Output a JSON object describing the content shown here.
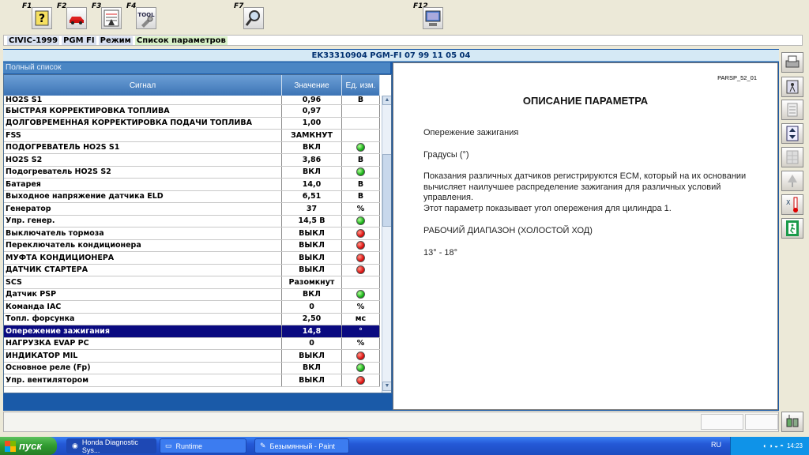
{
  "toolbar": {
    "keys": [
      {
        "label": "F1",
        "icon": "help-icon"
      },
      {
        "label": "F2",
        "icon": "car-icon"
      },
      {
        "label": "F3",
        "icon": "data-list-icon"
      },
      {
        "label": "F4",
        "icon": "tool-icon",
        "text": "TOOL"
      },
      {
        "label": "F7",
        "icon": "magnifier-icon"
      },
      {
        "label": "F12",
        "icon": "computer-icon"
      }
    ]
  },
  "breadcrumb": [
    "CIVIC-1999",
    "PGM FI",
    "Режим",
    "Список параметров"
  ],
  "ecu_header": "EK33310904  PGM-FI  07 99 11 05 04",
  "list_title": "Полный список",
  "table": {
    "headers": {
      "signal": "Сигнал",
      "value": "Значение",
      "unit": "Ед. изм."
    },
    "rows": [
      {
        "signal": "HO2S S1",
        "value": "0,96",
        "unit": "В"
      },
      {
        "signal": "БЫСТРАЯ КОРРЕКТИРОВКА ТОПЛИВА",
        "value": "0,97",
        "unit": ""
      },
      {
        "signal": "ДОЛГОВРЕМЕННАЯ КОРРЕКТИРОВКА ПОДАЧИ ТОПЛИВА",
        "value": "1,00",
        "unit": ""
      },
      {
        "signal": "FSS",
        "value": "ЗАМКНУТ",
        "unit": ""
      },
      {
        "signal": "ПОДОГРЕВАТЕЛЬ HO2S S1",
        "value": "ВКЛ",
        "unit": "",
        "status": "green"
      },
      {
        "signal": "HO2S S2",
        "value": "3,86",
        "unit": "В"
      },
      {
        "signal": "Подогреватель HO2S S2",
        "value": "ВКЛ",
        "unit": "",
        "status": "green"
      },
      {
        "signal": "Батарея",
        "value": "14,0",
        "unit": "В"
      },
      {
        "signal": "Выходное напряжение датчика ELD",
        "value": "6,51",
        "unit": "В"
      },
      {
        "signal": "Генератор",
        "value": "37",
        "unit": "%"
      },
      {
        "signal": "Упр. генер.",
        "value": "14,5 В",
        "unit": "",
        "status": "green"
      },
      {
        "signal": "Выключатель тормоза",
        "value": "ВЫКЛ",
        "unit": "",
        "status": "red"
      },
      {
        "signal": "Переключатель кондиционера",
        "value": "ВЫКЛ",
        "unit": "",
        "status": "red"
      },
      {
        "signal": "МУФТА КОНДИЦИОНЕРА",
        "value": "ВЫКЛ",
        "unit": "",
        "status": "red"
      },
      {
        "signal": "ДАТЧИК СТАРТЕРА",
        "value": "ВЫКЛ",
        "unit": "",
        "status": "red"
      },
      {
        "signal": "SCS",
        "value": "Разомкнут",
        "unit": ""
      },
      {
        "signal": "Датчик PSP",
        "value": "ВКЛ",
        "unit": "",
        "status": "green"
      },
      {
        "signal": "Команда IAC",
        "value": "0",
        "unit": "%"
      },
      {
        "signal": "Топл. форсунка",
        "value": "2,50",
        "unit": "мс"
      },
      {
        "signal": "Опережение зажигания",
        "value": "14,8",
        "unit": "°",
        "selected": true
      },
      {
        "signal": "НАГРУЗКА EVAP PC",
        "value": "0",
        "unit": "%"
      },
      {
        "signal": "ИНДИКАТОР MIL",
        "value": "ВЫКЛ",
        "unit": "",
        "status": "red"
      },
      {
        "signal": "Основное реле (Fp)",
        "value": "ВКЛ",
        "unit": "",
        "status": "green"
      },
      {
        "signal": "Упр. вентилятором",
        "value": "ВЫКЛ",
        "unit": "",
        "status": "red"
      }
    ]
  },
  "description": {
    "code": "PARSP_52_01",
    "title": "ОПИСАНИЕ ПАРАМЕТРА",
    "name": "Опережение зажигания",
    "units": "Градусы (°)",
    "text1": "Показания различных датчиков регистрируются ECM, который на их основании вычисляет наилучшее распределение зажигания для различных условий управления.",
    "text2": "Этот параметр показывает угол опережения для цилиндра 1.",
    "range_title": "РАБОЧИЙ ДИАПАЗОН (ХОЛОСТОЙ ХОД)",
    "range_value": "13° - 18°"
  },
  "right_toolbar": [
    "printer-icon",
    "person-icon",
    "list-icon",
    "updown-arrows-icon",
    "grid-icon",
    "tree-icon",
    "thermometer-icon",
    "exit-icon"
  ],
  "taskbar": {
    "start": "пуск",
    "tasks": [
      "Honda Diagnostic Sys...",
      "Runtime",
      "Безымянный - Paint"
    ],
    "lang": "RU",
    "clock": "14:23"
  },
  "colors": {
    "frame": "#1a5aa8",
    "selected_row": "#0a0a80",
    "header": "#4a86c4"
  }
}
